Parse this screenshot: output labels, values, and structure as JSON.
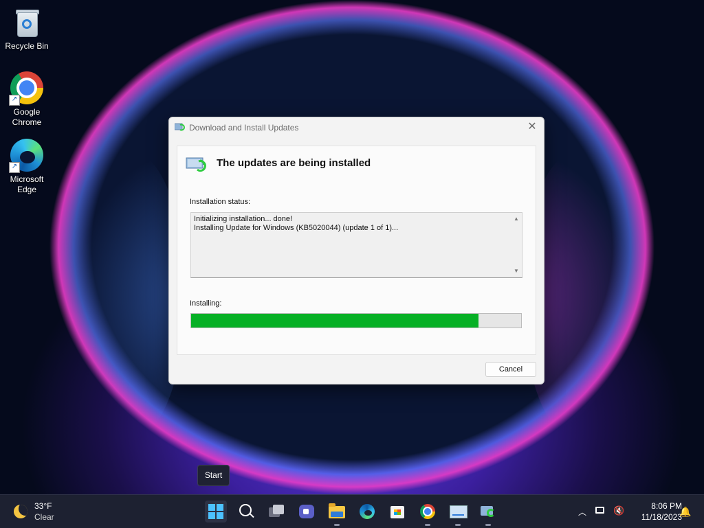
{
  "desktop": {
    "icons": [
      {
        "label": "Recycle Bin"
      },
      {
        "label": "Google Chrome"
      },
      {
        "label": "Microsoft Edge"
      }
    ]
  },
  "dialog": {
    "title": "Download and Install Updates",
    "close_glyph": "✕",
    "heading": "The updates are being installed",
    "status_label": "Installation status:",
    "status_lines": [
      "Initializing installation... done!",
      "Installing Update for Windows (KB5020044) (update 1 of 1)..."
    ],
    "installing_label": "Installing:",
    "progress_fraction": 0.87,
    "progress_color": "#06b025",
    "cancel_label": "Cancel"
  },
  "tooltip": {
    "text": "Start"
  },
  "taskbar": {
    "weather": {
      "temp": "33°F",
      "condition": "Clear",
      "icon": "moon-icon"
    },
    "apps": [
      {
        "name": "start-button",
        "icon": "windows-logo-icon"
      },
      {
        "name": "search-button",
        "icon": "search-icon"
      },
      {
        "name": "task-view-button",
        "icon": "task-view-icon"
      },
      {
        "name": "teams-chat-button",
        "icon": "teams-chat-icon"
      },
      {
        "name": "file-explorer-button",
        "icon": "folder-icon"
      },
      {
        "name": "edge-button",
        "icon": "edge-icon"
      },
      {
        "name": "store-button",
        "icon": "store-icon"
      },
      {
        "name": "chrome-button",
        "icon": "chrome-icon"
      },
      {
        "name": "system-monitor-button",
        "icon": "monitor-chart-icon"
      },
      {
        "name": "windows-update-button",
        "icon": "update-icon"
      }
    ],
    "tray": {
      "time": "8:06 PM",
      "date": "11/18/2023"
    }
  }
}
